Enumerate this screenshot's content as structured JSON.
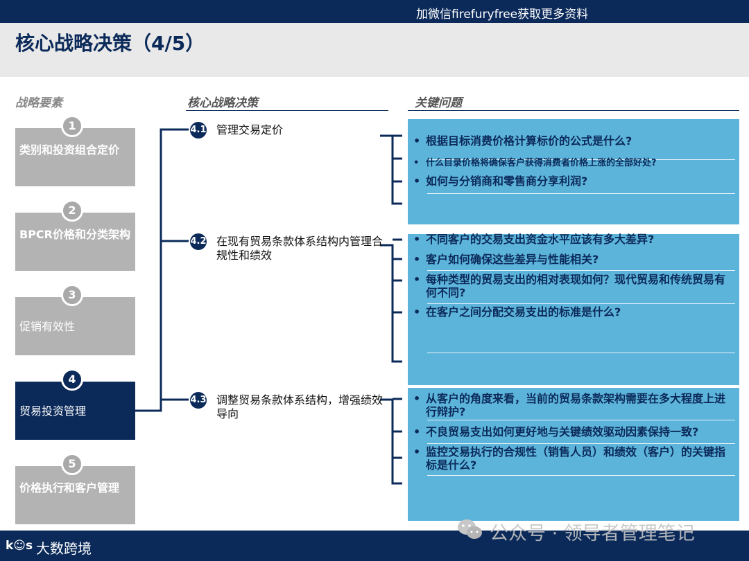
{
  "header": {
    "banner_text": "加微信firefuryfree获取更多资料",
    "title": "核心战略决策（4/5）"
  },
  "columns": {
    "elements": "战略要素",
    "decisions": "核心战略决策",
    "questions": "关键问题"
  },
  "elements": [
    {
      "num": "1",
      "label": "类别和投资组合定价",
      "active": false
    },
    {
      "num": "2",
      "label": "BPCR价格和分类架构",
      "active": false
    },
    {
      "num": "3",
      "label": "促销有效性",
      "active": false
    },
    {
      "num": "4",
      "label": "贸易投资管理",
      "active": true
    },
    {
      "num": "5",
      "label": "价格执行和客户管理",
      "active": false
    }
  ],
  "decisions": [
    {
      "num": "4.1",
      "label": "管理交易定价"
    },
    {
      "num": "4.2",
      "label": "在现有贸易条款体系结构内管理合规性和绩效"
    },
    {
      "num": "4.3",
      "label": "调整贸易条款体系结构，增强绩效导向"
    }
  ],
  "questions": [
    [
      "根据目标消费价格计算标价的公式是什么?",
      "什么目录价格将确保客户获得消费者价格上涨的全部好处?",
      "如何与分销商和零售商分享利润?"
    ],
    [
      "不同客户的交易支出资金水平应该有多大差异?",
      "客户如何确保这些差异与性能相关?",
      "每种类型的贸易支出的相对表现如何？现代贸易和传统贸易有何不同?",
      "在客户之间分配交易支出的标准是什么?"
    ],
    [
      "从客户的角度来看，当前的贸易条款架构需要在多大程度上进行辩护?",
      "不良贸易支出如何更好地与关键绩效驱动因素保持一致?",
      "监控交易执行的合规性（销售人员）和绩效（客户）的关键指标是什么?"
    ]
  ],
  "footer": {
    "brand_icon": "k☺s",
    "brand_text": "大数跨境",
    "watermark": "公众号 · 领导者管理笔记"
  },
  "colors": {
    "navy": "#0b2a5a",
    "question_fill": "#5db4da",
    "inactive_box": "#b3b3b3"
  },
  "icons": [
    "wechat-icon"
  ]
}
